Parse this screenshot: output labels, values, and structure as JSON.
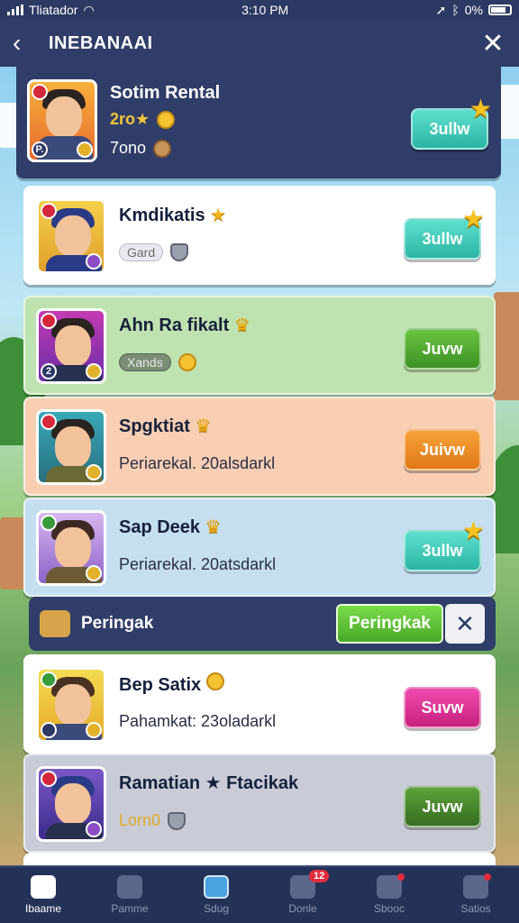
{
  "status": {
    "carrier": "Tliatador",
    "time": "3:10 PM",
    "battery": "0%"
  },
  "header": {
    "title": "INEBANAAI"
  },
  "cards": [
    {
      "name": "Sotim Rental",
      "line1": "2ro★",
      "line2": "7ono",
      "button": "3ullw",
      "color": "#2f3d68",
      "button_style": "teal",
      "badge": "P."
    },
    {
      "name": "Kmdikatis",
      "pill": "Gard",
      "button": "3ullw",
      "color": "#ffffff",
      "button_style": "teal"
    },
    {
      "name": "Ahn Ra fikalt",
      "pill": "Xands",
      "button": "Juvw",
      "color": "#bfe3b0",
      "button_style": "green",
      "badge": "2"
    },
    {
      "name": "Spgktiat",
      "desc": "Periarekal. 20alsdarkl",
      "button": "Juivw",
      "color": "#f8cfb3",
      "button_style": "orange"
    },
    {
      "name": "Sap Deek",
      "desc": "Periarekal. 20atsdarkl",
      "button": "3ullw",
      "color": "#c5dff0",
      "button_style": "teal"
    },
    {
      "name": "Bep Satix",
      "desc": "Pahamkat: 23oladarkl",
      "button": "Suvw",
      "color": "#ffffff",
      "button_style": "pink"
    },
    {
      "name": "Ramatian ★ Ftacikak",
      "line1": "Lorn0",
      "button": "Juvw",
      "color": "#c9ccd6",
      "button_style": "dgreen"
    }
  ],
  "notice": {
    "text": "Peringak",
    "button": "Peringkak",
    "close": "✕"
  },
  "nav": [
    {
      "label": "Ibaame",
      "icon": "home-icon"
    },
    {
      "label": "Pamme",
      "icon": "box-icon"
    },
    {
      "label": "Sdug",
      "icon": "shield-icon"
    },
    {
      "label": "Donle",
      "icon": "mail-icon",
      "badge": "12"
    },
    {
      "label": "Sbooc",
      "icon": "gift-icon"
    },
    {
      "label": "Satios",
      "icon": "profile-icon"
    }
  ]
}
